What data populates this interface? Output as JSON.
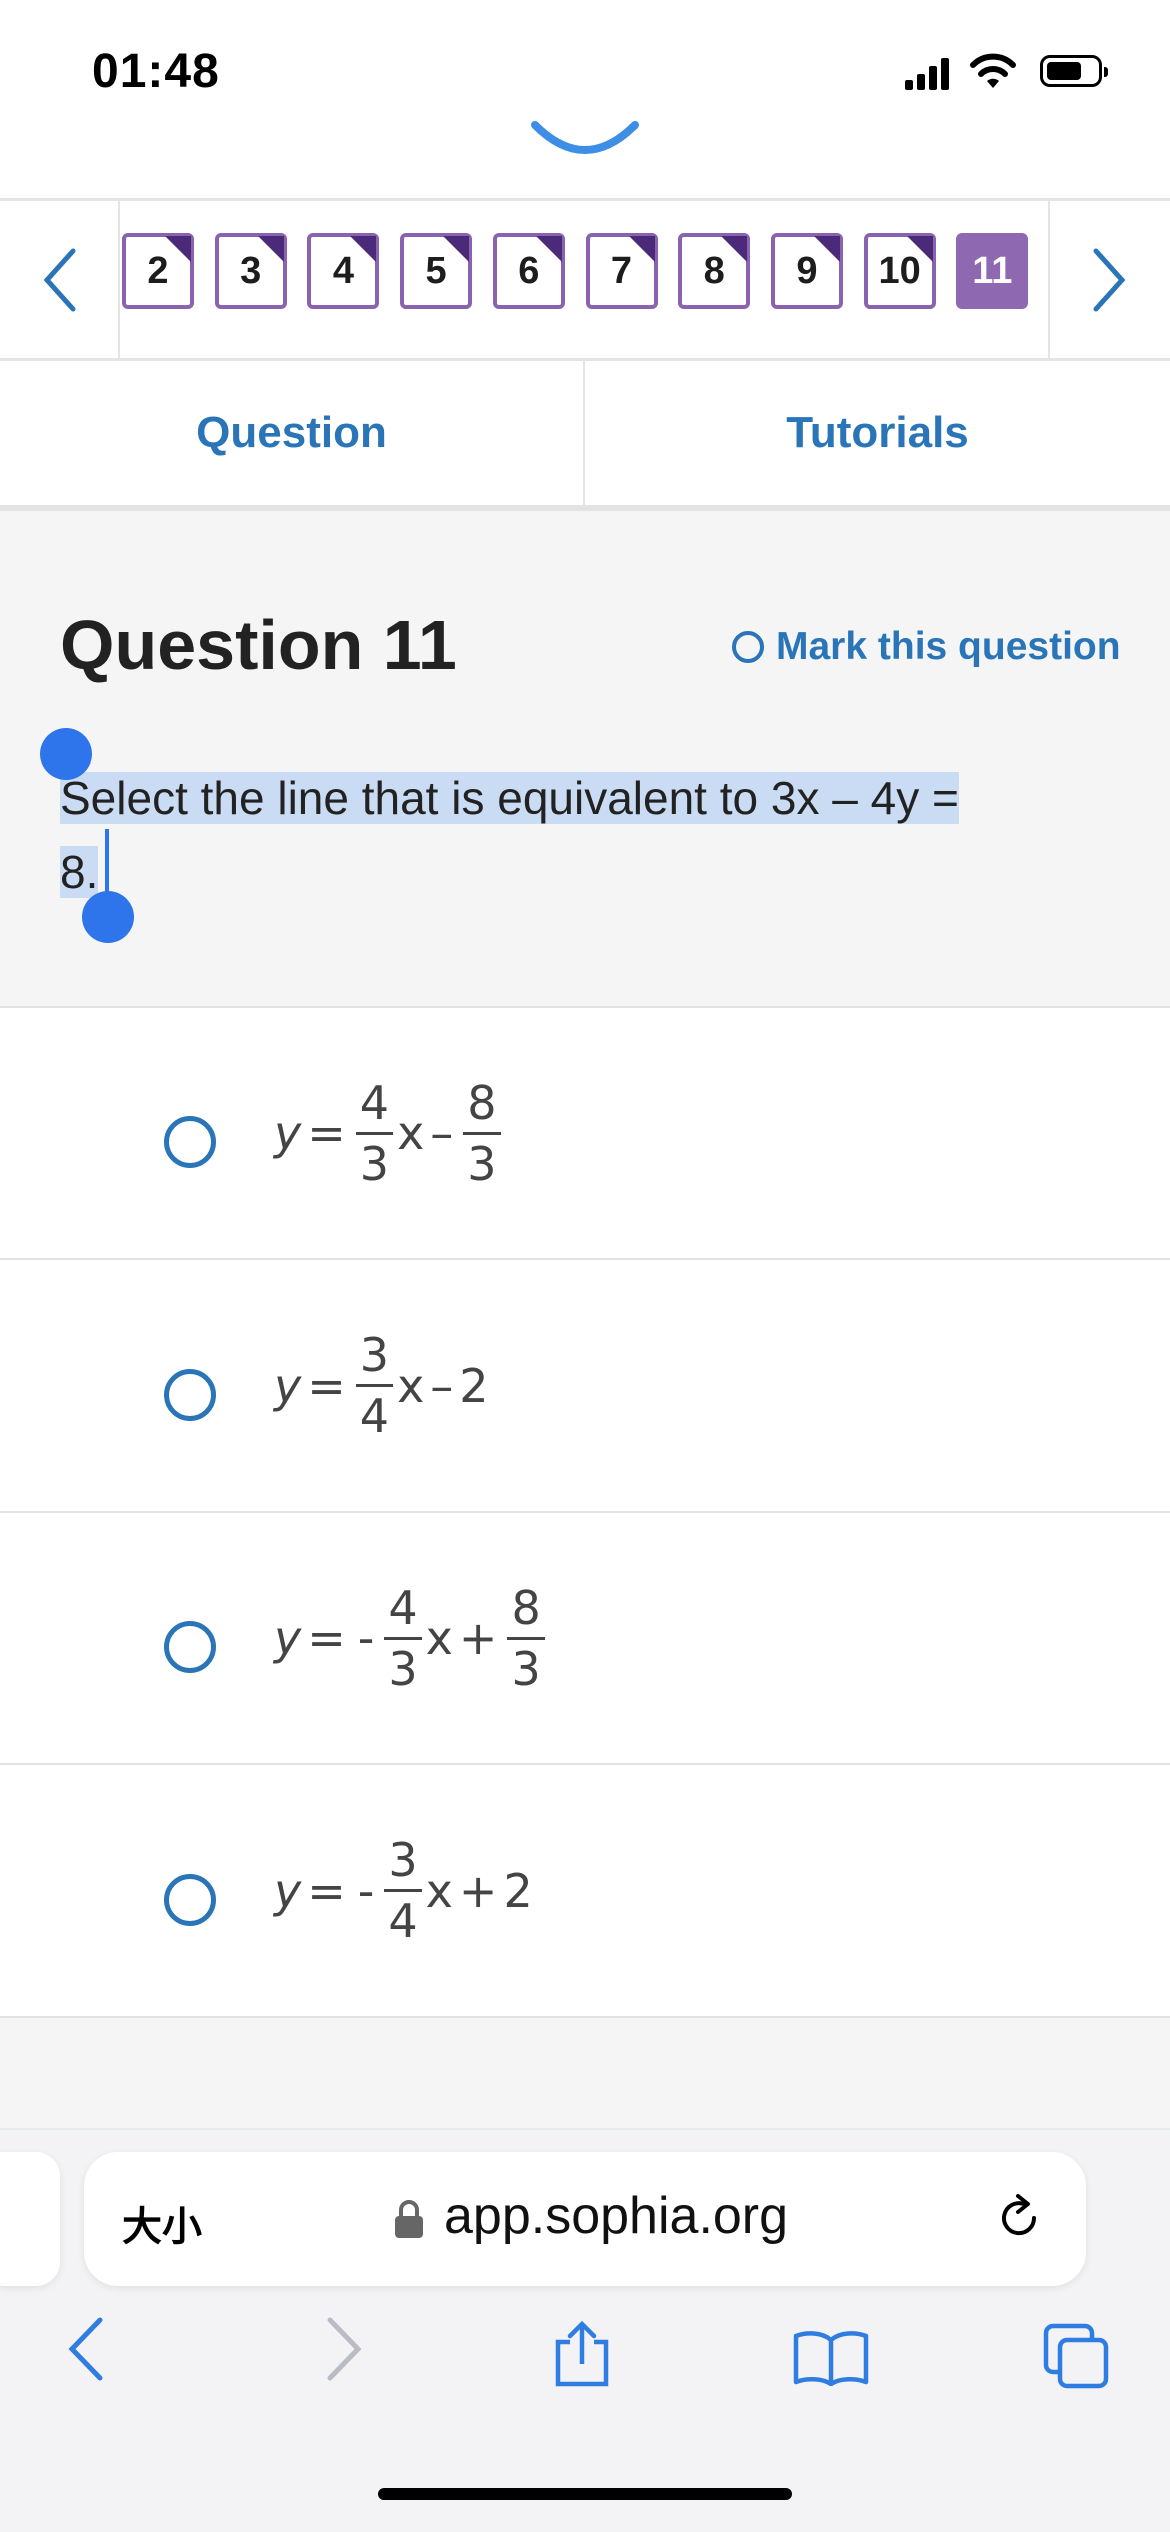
{
  "status_bar": {
    "time": "01:48"
  },
  "question_nav": {
    "items": [
      {
        "label": "2",
        "current": false
      },
      {
        "label": "3",
        "current": false
      },
      {
        "label": "4",
        "current": false
      },
      {
        "label": "5",
        "current": false
      },
      {
        "label": "6",
        "current": false
      },
      {
        "label": "7",
        "current": false
      },
      {
        "label": "8",
        "current": false
      },
      {
        "label": "9",
        "current": false
      },
      {
        "label": "10",
        "current": false
      },
      {
        "label": "11",
        "current": true
      }
    ],
    "prev_icon": "chevron-left-icon",
    "next_icon": "chevron-right-icon"
  },
  "tabs": {
    "question": "Question",
    "tutorials": "Tutorials"
  },
  "question": {
    "title": "Question 11",
    "mark_label": "Mark this question",
    "text_line1": "Select the line that is equivalent to 3x – 4y =",
    "text_line2": "8."
  },
  "options": [
    {
      "lhs": "y",
      "eq": "=",
      "sign": "",
      "num1": "4",
      "den1": "3",
      "var": "x",
      "op2": "–",
      "num2": "8",
      "den2": "3",
      "tail": ""
    },
    {
      "lhs": "y",
      "eq": "=",
      "sign": "",
      "num1": "3",
      "den1": "4",
      "var": "x",
      "op2": "–",
      "num2": "",
      "den2": "",
      "tail": "2"
    },
    {
      "lhs": "y",
      "eq": "=",
      "sign": "-",
      "num1": "4",
      "den1": "3",
      "var": "x",
      "op2": "+",
      "num2": "8",
      "den2": "3",
      "tail": ""
    },
    {
      "lhs": "y",
      "eq": "=",
      "sign": "-",
      "num1": "3",
      "den1": "4",
      "var": "x",
      "op2": "+",
      "num2": "",
      "den2": "",
      "tail": "2"
    }
  ],
  "browser": {
    "aa_label": "大小",
    "url": "app.sophia.org"
  },
  "colors": {
    "accent_blue": "#2a74b8",
    "purple": "#8a63b0",
    "selection": "#c9dcf3"
  }
}
